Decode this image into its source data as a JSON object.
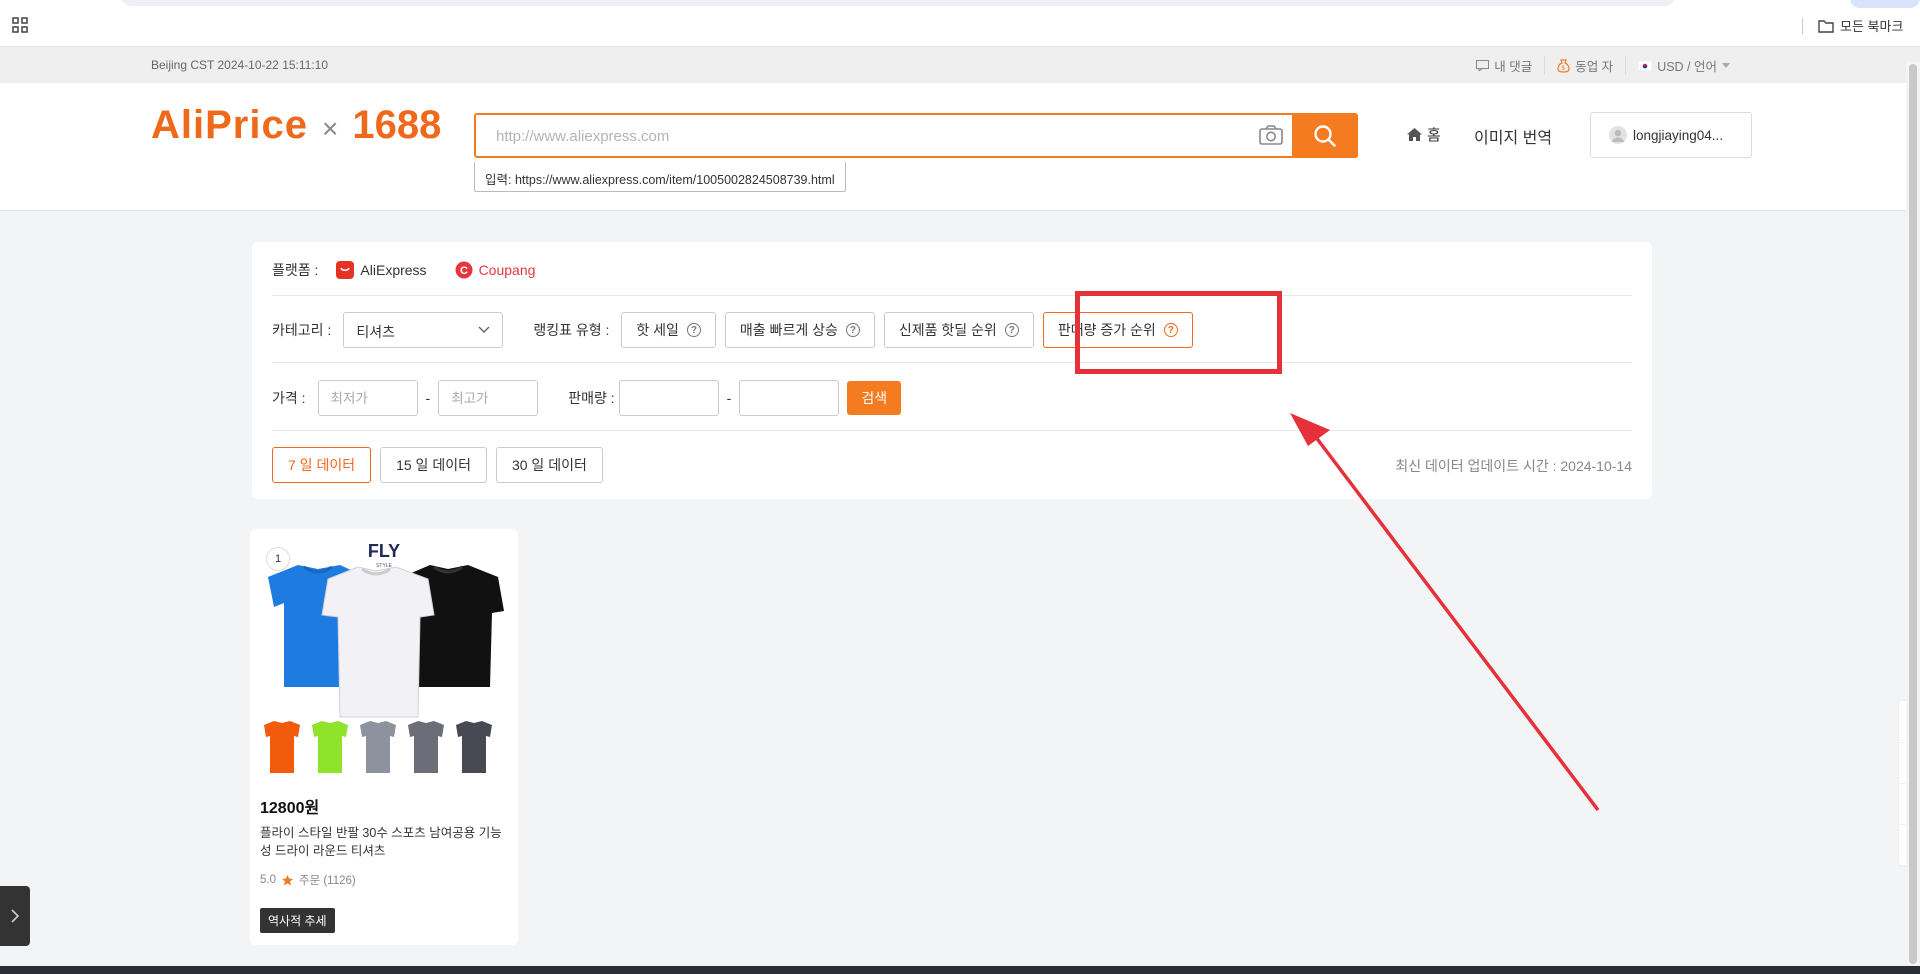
{
  "browser": {
    "bookmarks_label": "모든 북마크"
  },
  "topbar": {
    "timezone": "Beijing CST  2024-10-22 15:11:10",
    "my_comments": "내 댓글",
    "affiliate": "동업 자",
    "currency_lang": "USD / 언어"
  },
  "header": {
    "logo_left": "AliPrice",
    "logo_x": "×",
    "logo_right": "1688",
    "search_placeholder": "http://www.aliexpress.com",
    "hint_label": "입력:",
    "hint_url": "https://www.aliexpress.com/item/1005002824508739.html",
    "nav_home": "홈",
    "nav_image_translate": "이미지 번역",
    "user_name": "longjiaying04..."
  },
  "filters": {
    "platform_label": "플랫폼 :",
    "platforms": [
      {
        "name": "AliExpress",
        "color": "#333333",
        "icon_color": "#e43225"
      },
      {
        "name": "Coupang",
        "color": "#e4373d",
        "icon_color": "#e4373d"
      }
    ],
    "category_label": "카테고리 :",
    "category_value": "티셔츠",
    "ranking_label": "랭킹표 유형 :",
    "ranking_types": [
      "핫 세일",
      "매출 빠르게 상승",
      "신제품 핫딜 순위",
      "판매량 증가 순위"
    ],
    "ranking_active": "판매량 증가 순위",
    "price_label": "가격 :",
    "price_min_placeholder": "최저가",
    "price_max_placeholder": "최고가",
    "sales_label": "판매량 :",
    "dash": "-",
    "search_button": "검색",
    "periods": [
      "7 일 데이터",
      "15 일 데이터",
      "30 일 데이터"
    ],
    "period_active": "7 일 데이터",
    "update_text": "최신 데이터 업데이트 시간 : 2024-10-14"
  },
  "product": {
    "rank": "1",
    "brand": "FLY",
    "brand_sub": "STYLE",
    "price": "12800원",
    "title": "플라이 스타일 반팔 30수 스포츠 남여공용 기능성 드라이 라운드 티셔츠",
    "rating": "5.0",
    "orders": "주문 (1126)",
    "trend_button": "역사적 추세"
  },
  "colors": {
    "accent": "#f47b20",
    "highlight_red": "#e5323a"
  }
}
